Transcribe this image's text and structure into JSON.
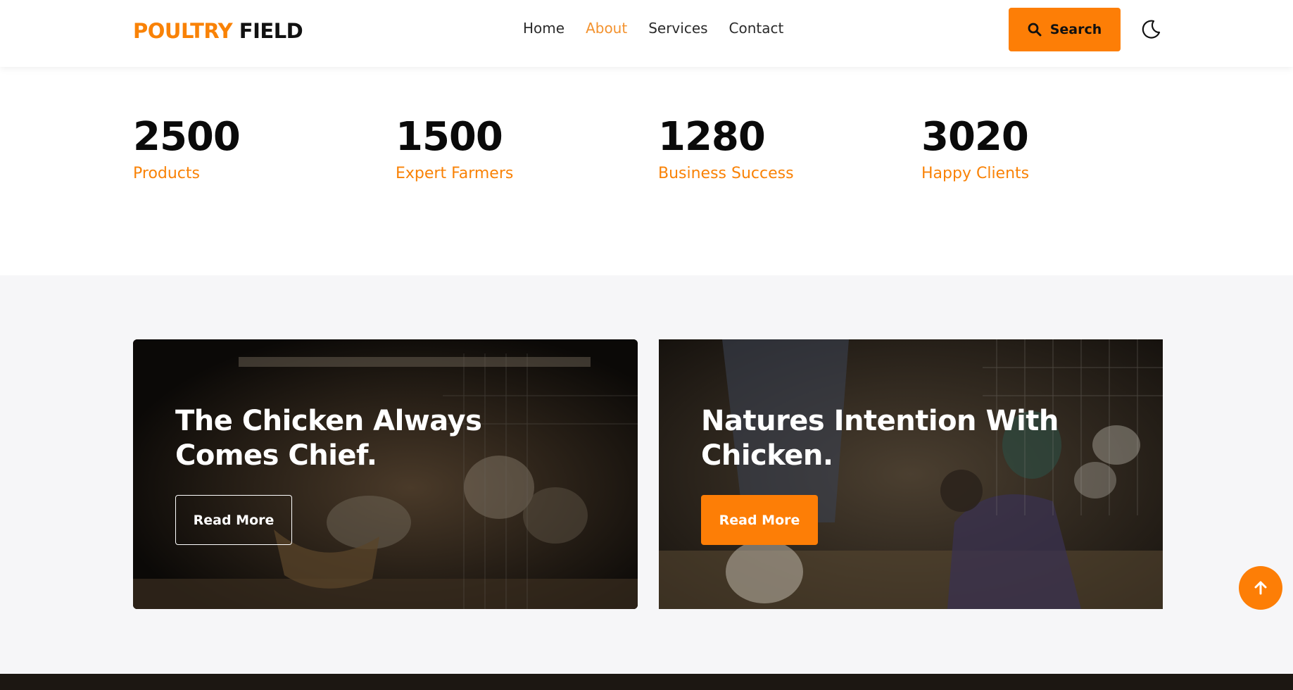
{
  "brand": {
    "part1": "POULTRY",
    "part2": "FIELD",
    "accent": "#fd7e06"
  },
  "nav": {
    "items": [
      {
        "label": "Home",
        "active": false
      },
      {
        "label": "About",
        "active": true
      },
      {
        "label": "Services",
        "active": false
      },
      {
        "label": "Contact",
        "active": false
      }
    ]
  },
  "header": {
    "search_label": "Search",
    "search_icon": "search-icon",
    "theme_icon": "moon-icon"
  },
  "stats": [
    {
      "value": "2500",
      "label": "Products"
    },
    {
      "value": "1500",
      "label": "Expert Farmers"
    },
    {
      "value": "1280",
      "label": "Business Success"
    },
    {
      "value": "3020",
      "label": "Happy Clients"
    }
  ],
  "cards": [
    {
      "title": "The Chicken Always Comes Chief.",
      "button": "Read More",
      "button_style": "outline"
    },
    {
      "title": "Natures Intention With Chicken.",
      "button": "Read More",
      "button_style": "filled"
    }
  ],
  "scroll_top_icon": "arrow-up-icon"
}
